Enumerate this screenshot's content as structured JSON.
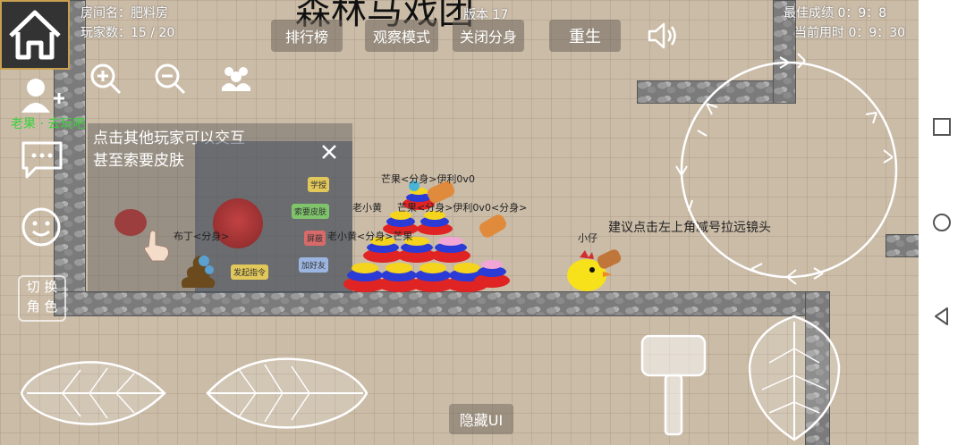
{
  "hud": {
    "room_name": "房间名：肥料房",
    "player_count": "玩家数：15 / 20",
    "game_title": "森林马戏团",
    "version": "版本 17",
    "best_score": "最佳成绩  0：9：8",
    "current_time": "当前用时  0：9：30"
  },
  "top_buttons": {
    "leaderboard": "排行榜",
    "observe": "观察模式",
    "close_clone": "关闭分身",
    "respawn": "重生"
  },
  "left_panel": {
    "friend_name": "老果 · 去玩吧"
  },
  "switch_role": {
    "line1": "切 换",
    "line2": "角 色"
  },
  "tip": {
    "line1": "点击其他玩家可以交互",
    "line2": "甚至索要皮肤"
  },
  "inner_panel": {
    "btn_learn": "学授",
    "btn_skin": "索要皮肤",
    "btn_ban": "屏蔽",
    "btn_friend": "加好友",
    "btn_init": "发起指令"
  },
  "name_tags": {
    "tag1": "芒果<分身>伊利0v0",
    "tag2": "老小黄",
    "tag3": "芒果<分身>伊利0v0<分身>",
    "tag4": "布丁<分身>",
    "tag5": "老小黄<分身>芒果",
    "tag6": "小仔"
  },
  "hint": "建议点击左上角减号拉远镜头",
  "hide_ui": "隐藏UI",
  "colors": {
    "wall": "#7b7b7b",
    "grid_bg": "#cbbca8",
    "friend_green": "#3bd13b"
  }
}
